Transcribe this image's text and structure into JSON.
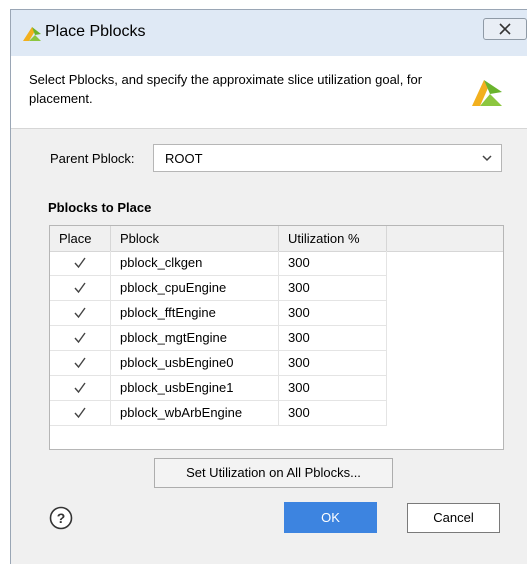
{
  "dialog": {
    "title": "Place Pblocks",
    "close_icon": "close-icon",
    "description": "Select Pblocks, and specify the approximate slice utilization goal, for placement.",
    "logo_icon": "vivado-logo-icon"
  },
  "parent": {
    "label": "Parent Pblock:",
    "value": "ROOT"
  },
  "pblocks": {
    "section_title": "Pblocks to Place",
    "columns": [
      "Place",
      "Pblock",
      "Utilization %"
    ],
    "rows": [
      {
        "checked": true,
        "name": "pblock_clkgen",
        "utilization": "300"
      },
      {
        "checked": true,
        "name": "pblock_cpuEngine",
        "utilization": "300"
      },
      {
        "checked": true,
        "name": "pblock_fftEngine",
        "utilization": "300"
      },
      {
        "checked": true,
        "name": "pblock_mgtEngine",
        "utilization": "300"
      },
      {
        "checked": true,
        "name": "pblock_usbEngine0",
        "utilization": "300"
      },
      {
        "checked": true,
        "name": "pblock_usbEngine1",
        "utilization": "300"
      },
      {
        "checked": true,
        "name": "pblock_wbArbEngine",
        "utilization": "300"
      }
    ]
  },
  "buttons": {
    "set_utilization": "Set Utilization on All Pblocks...",
    "ok": "OK",
    "cancel": "Cancel",
    "help_icon": "help-icon"
  },
  "colors": {
    "title_bar": "#dfe9f5",
    "ok_button": "#3d84e0",
    "dialog_bg": "#f0f0f0"
  }
}
